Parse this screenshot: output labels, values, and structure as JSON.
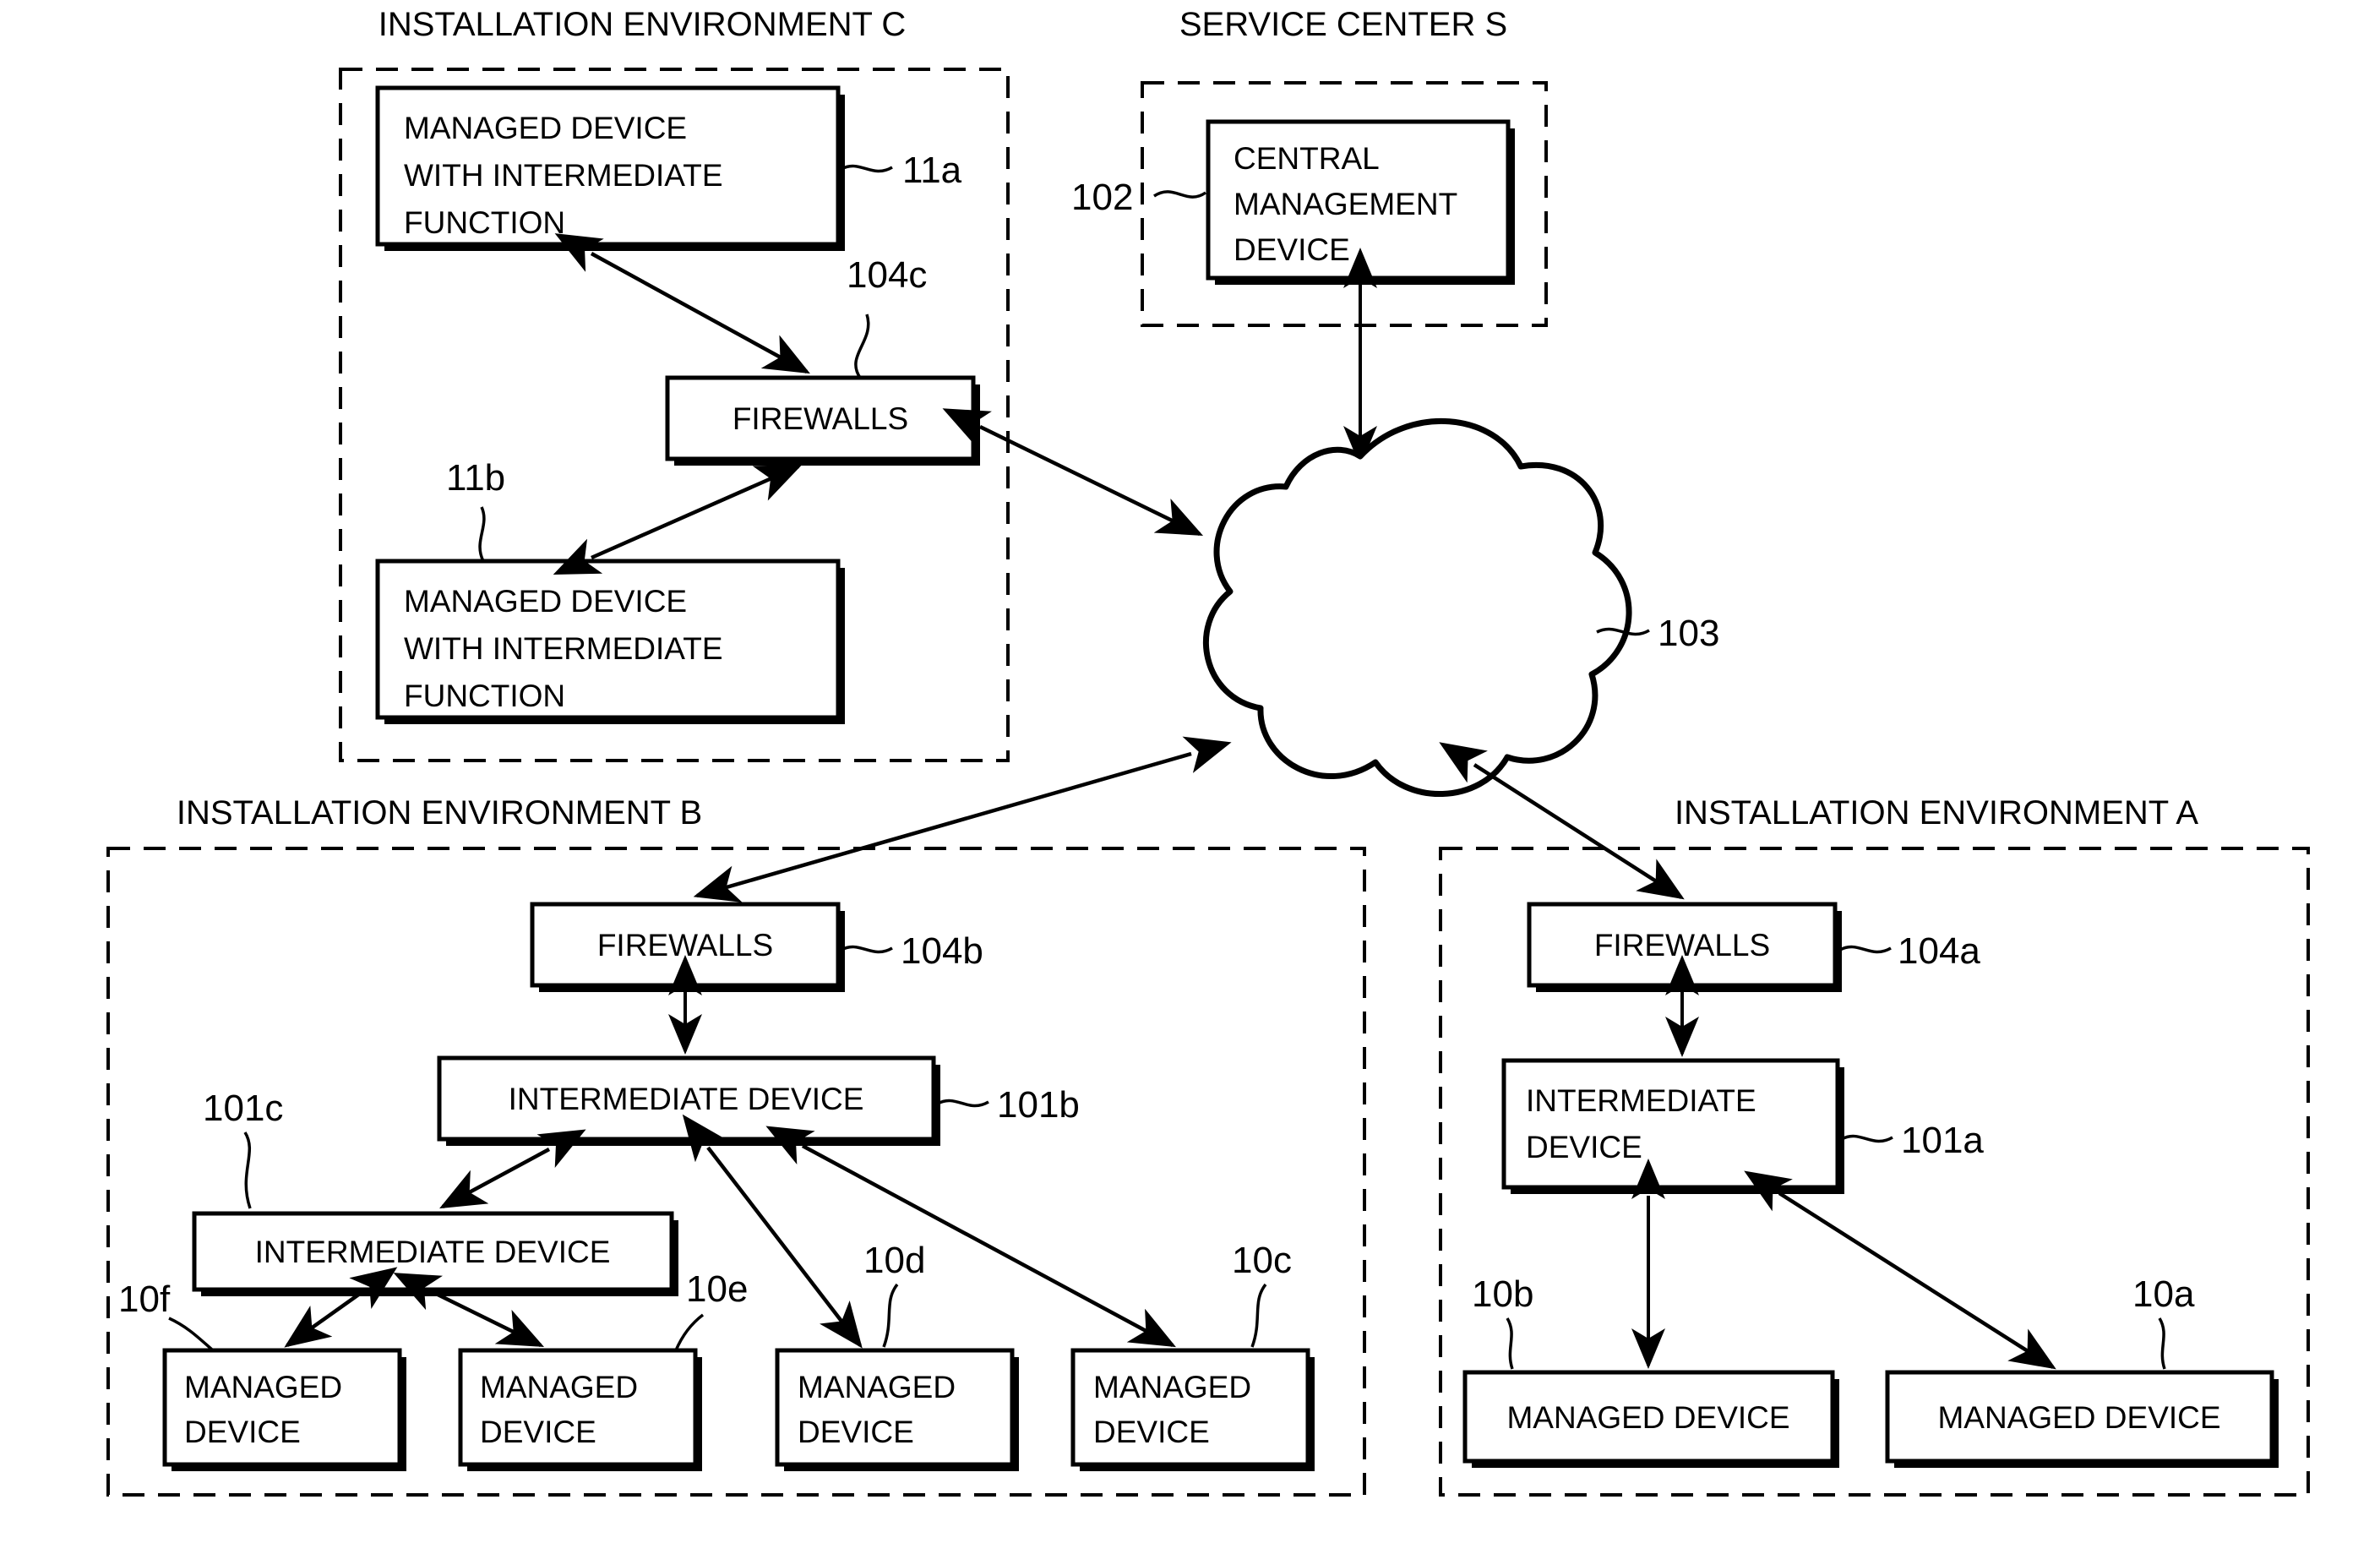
{
  "figure": {
    "type": "network-architecture-diagram",
    "regions": [
      {
        "id": "env-c",
        "title": "INSTALLATION ENVIRONMENT C"
      },
      {
        "id": "service-center",
        "title": "SERVICE CENTER S"
      },
      {
        "id": "env-b",
        "title": "INSTALLATION ENVIRONMENT B"
      },
      {
        "id": "env-a",
        "title": "INSTALLATION ENVIRONMENT A"
      }
    ],
    "nodes": {
      "managed_device_intermediate_top": {
        "line1": "MANAGED DEVICE",
        "line2": "WITH INTERMEDIATE",
        "line3": "FUNCTION",
        "ref": "11a"
      },
      "managed_device_intermediate_bottom": {
        "line1": "MANAGED DEVICE",
        "line2": "WITH INTERMEDIATE",
        "line3": "FUNCTION",
        "ref": "11b"
      },
      "firewalls_c": {
        "label": "FIREWALLS",
        "ref": "104c"
      },
      "central_management_device": {
        "line1": "CENTRAL",
        "line2": "MANAGEMENT",
        "line3": "DEVICE",
        "ref": "102"
      },
      "network_cloud": {
        "ref": "103"
      },
      "firewalls_b": {
        "label": "FIREWALLS",
        "ref": "104b"
      },
      "intermediate_device_b": {
        "label": "INTERMEDIATE DEVICE",
        "ref": "101b"
      },
      "intermediate_device_c": {
        "label": "INTERMEDIATE DEVICE",
        "ref": "101c"
      },
      "managed_device_10f": {
        "line1": "MANAGED",
        "line2": "DEVICE",
        "ref": "10f"
      },
      "managed_device_10e": {
        "line1": "MANAGED",
        "line2": "DEVICE",
        "ref": "10e"
      },
      "managed_device_10d": {
        "line1": "MANAGED",
        "line2": "DEVICE",
        "ref": "10d"
      },
      "managed_device_10c": {
        "line1": "MANAGED",
        "line2": "DEVICE",
        "ref": "10c"
      },
      "firewalls_a": {
        "label": "FIREWALLS",
        "ref": "104a"
      },
      "intermediate_device_a": {
        "line1": "INTERMEDIATE",
        "line2": "DEVICE",
        "ref": "101a"
      },
      "managed_device_10b": {
        "label": "MANAGED DEVICE",
        "ref": "10b"
      },
      "managed_device_10a": {
        "label": "MANAGED DEVICE",
        "ref": "10a"
      }
    },
    "colors": {
      "stroke": "#000000",
      "fill": "#ffffff"
    }
  }
}
